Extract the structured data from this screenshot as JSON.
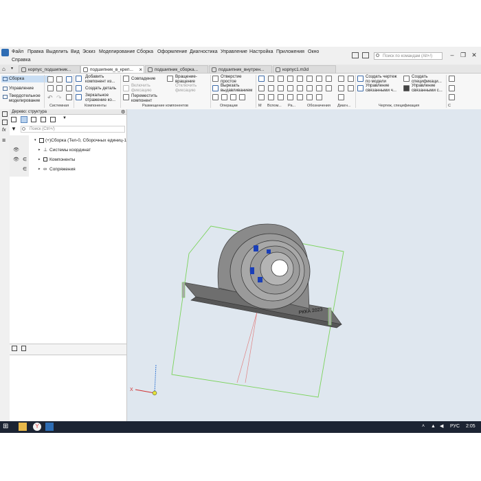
{
  "menu": [
    "Файл",
    "Правка",
    "Выделить",
    "Вид",
    "Эскиз",
    "Моделирование",
    "Сборка",
    "Оформление",
    "Диагностика",
    "Управление",
    "Настройка",
    "Приложения",
    "Окно",
    "Справка"
  ],
  "search_placeholder": "Поиск по командам (Alt+/)",
  "tabs": [
    "корпус_подшипник...",
    "подшипник_в_креп...",
    "подшипник_сборка...",
    "подшипник_внутрен...",
    "корпус1.m3d"
  ],
  "ribbon": {
    "modes": [
      "Сборка",
      "Управление",
      "Твердотельное",
      "моделирование"
    ],
    "components": {
      "add": [
        "Добавить",
        "компонент из..."
      ],
      "create": "Создать деталь",
      "mirror": [
        "Зеркальное",
        "отражение ко..."
      ]
    },
    "placement": {
      "coincide": "Совпадение",
      "enable": [
        "Включить",
        "фиксацию"
      ],
      "move": [
        "Переместить",
        "компонент"
      ],
      "rotate": [
        "Вращение-",
        "вращение"
      ],
      "disable": [
        "Отключить",
        "фиксацию"
      ]
    },
    "operations": {
      "hole": [
        "Отверстие",
        "простое"
      ],
      "cut": [
        "Вырезать",
        "выдавливанием"
      ]
    },
    "drawing": {
      "create_drawing": [
        "Создать чертеж",
        "по модели"
      ],
      "manage_linked": [
        "Управление",
        "связанными ч..."
      ],
      "create_spec": [
        "Создать",
        "спецификаци..."
      ],
      "manage_spec": [
        "Управление",
        "связанными с..."
      ]
    },
    "groups": [
      "Системная",
      "Компоненты",
      "Размещение компонентов",
      "Операции",
      "М",
      "Вспом...",
      "Ра...",
      "Обозначения",
      "Диагн...",
      "Чертеж, спецификация",
      "С"
    ]
  },
  "panel": {
    "title": "Дерево: структура",
    "search_placeholder": "Поиск (Ctrl+/)",
    "root": "(+)Сборка (Тел-0, Сборочных единиц-1",
    "items": [
      "Системы координат",
      "Компоненты",
      "Сопряжения"
    ]
  },
  "model_text": "РККА 2023",
  "axis_x": "X",
  "taskbar": {
    "lang": "РУС",
    "time": "2:05"
  },
  "colors": {
    "accent": "#2e6db4",
    "viewport": "#dfe7ef",
    "part": "#7c7c7c",
    "bearing_blue": "#1a3fb8",
    "bbox": "#7ad35a"
  }
}
